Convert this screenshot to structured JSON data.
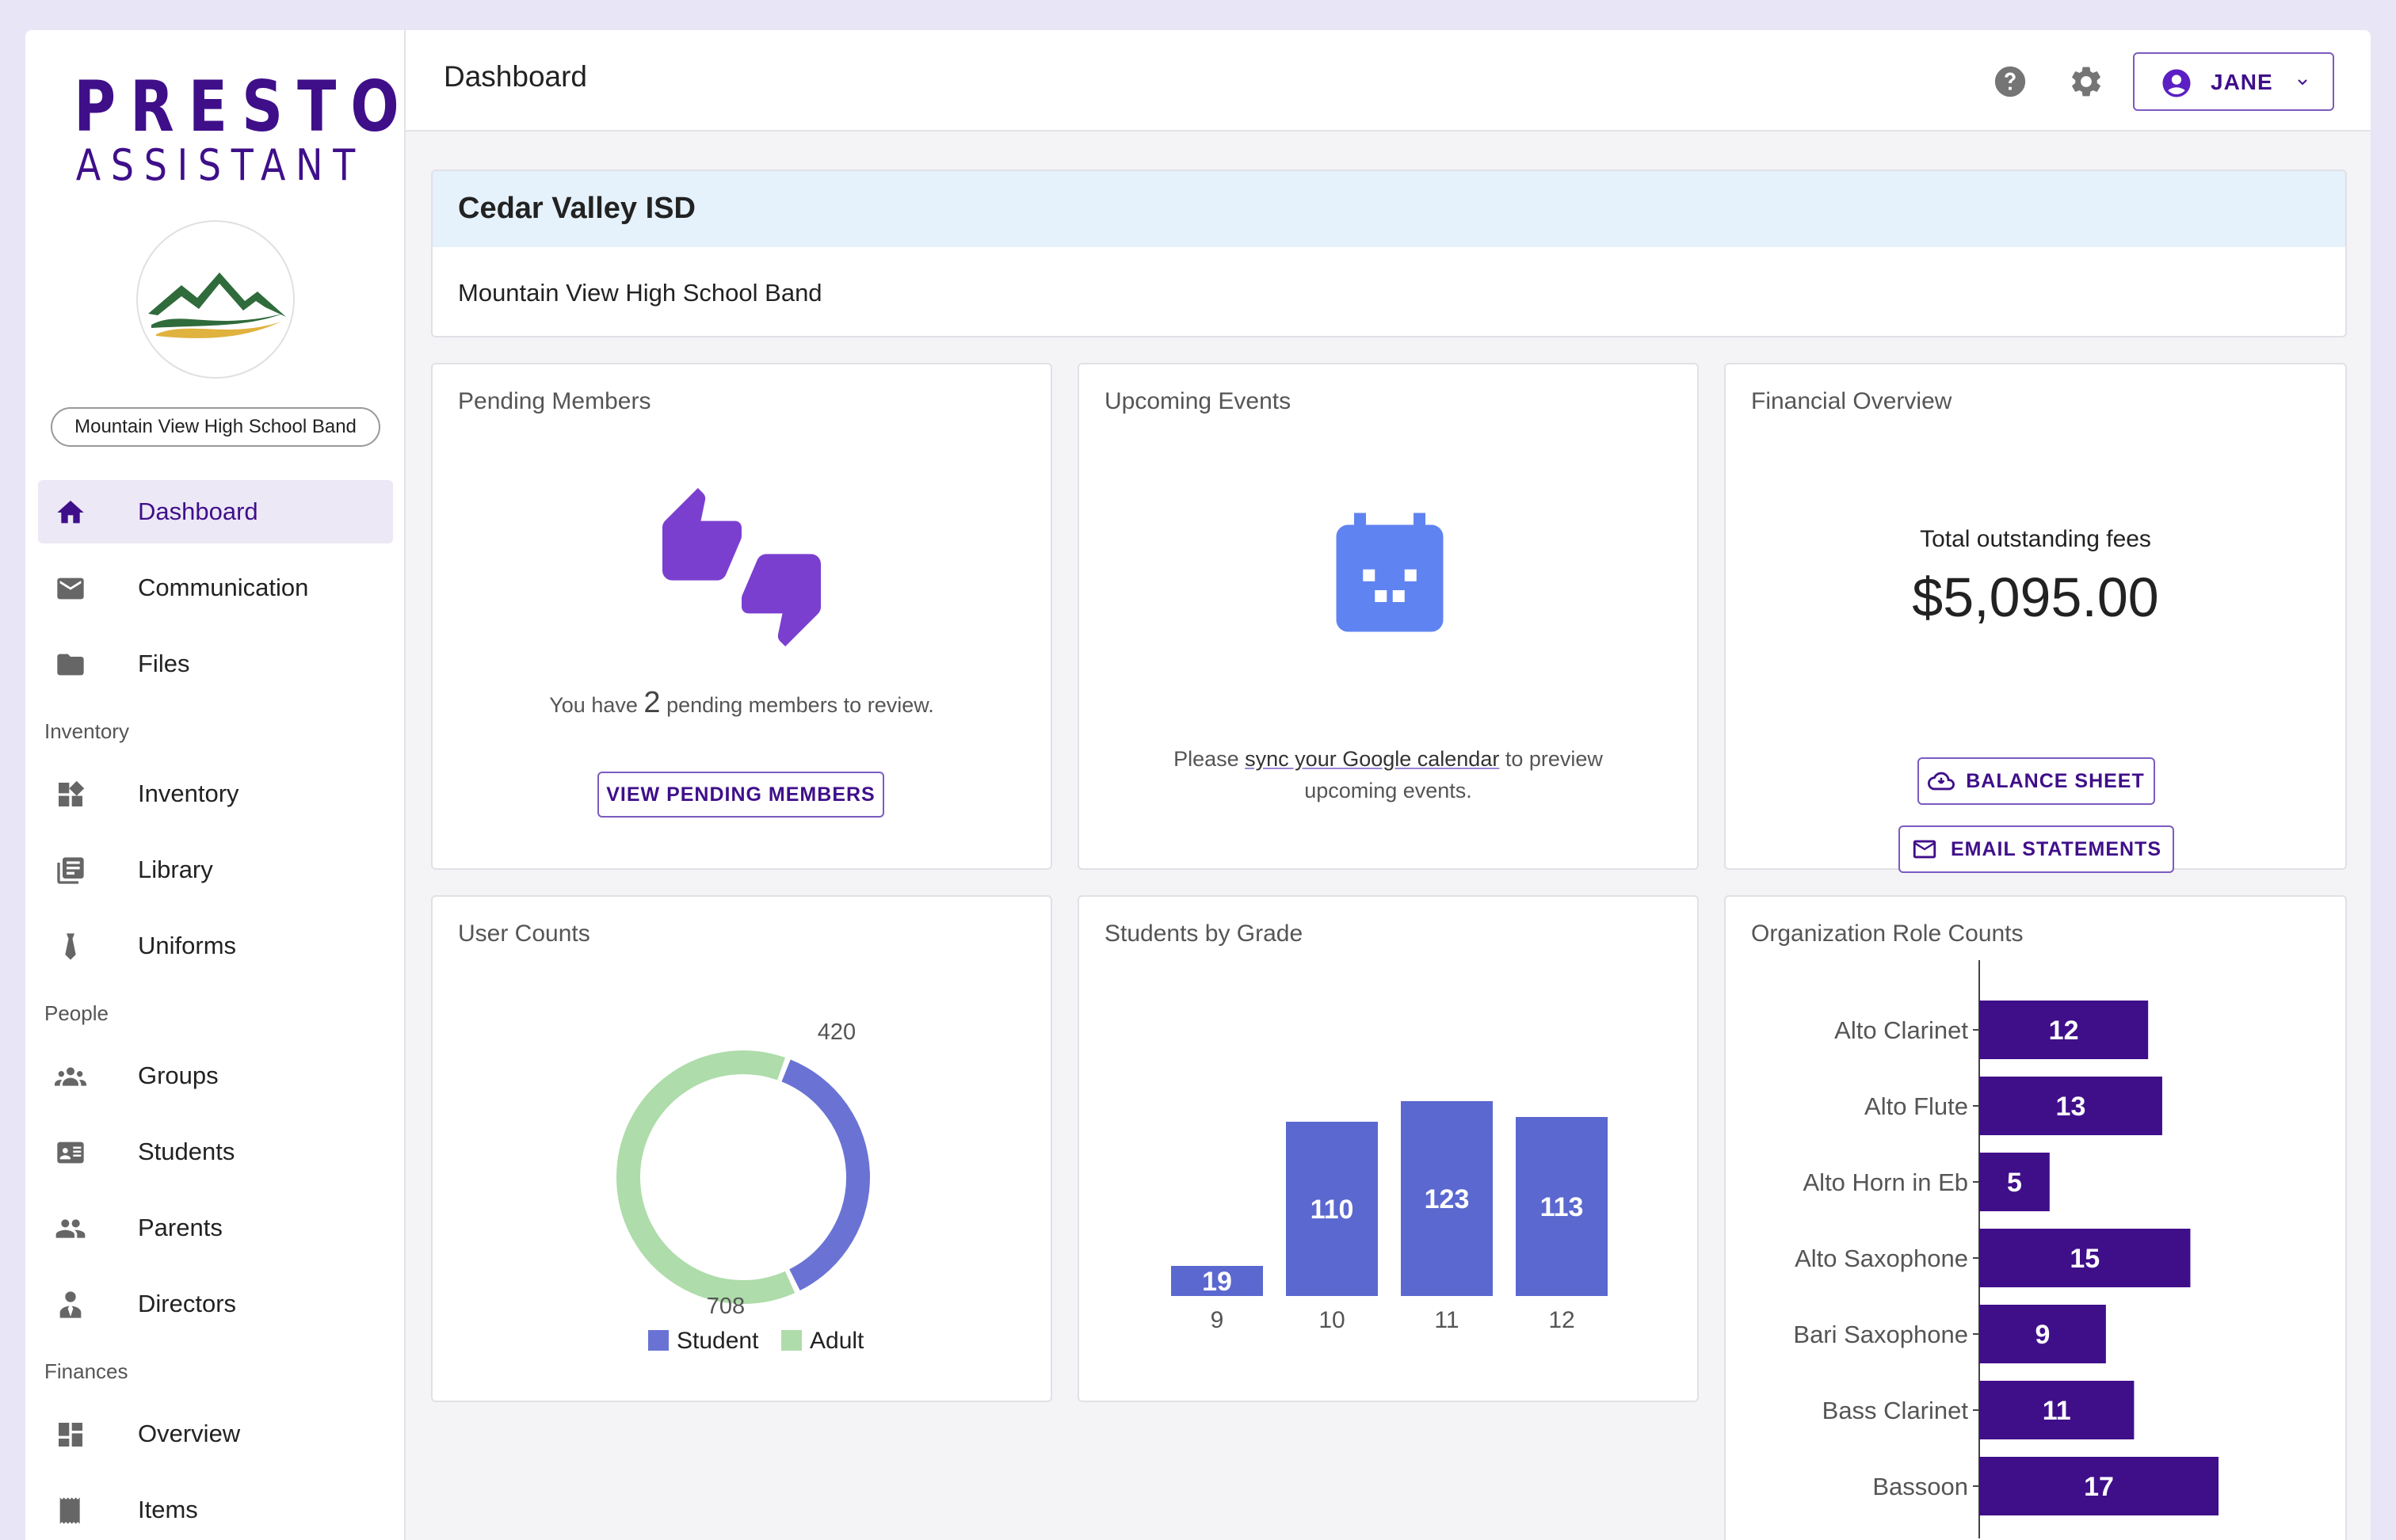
{
  "brand": {
    "line1": "PRESTO",
    "line2": "ASSISTANT"
  },
  "org_chip": "Mountain View High School Band",
  "nav": {
    "dashboard": "Dashboard",
    "communication": "Communication",
    "files": "Files",
    "inventory_section": "Inventory",
    "inventory": "Inventory",
    "library": "Library",
    "uniforms": "Uniforms",
    "people_section": "People",
    "groups": "Groups",
    "students": "Students",
    "parents": "Parents",
    "directors": "Directors",
    "finances_section": "Finances",
    "overview": "Overview",
    "items": "Items"
  },
  "header": {
    "title": "Dashboard",
    "user": "JANE"
  },
  "org_card": {
    "district": "Cedar Valley ISD",
    "organization": "Mountain View High School Band"
  },
  "pending": {
    "title": "Pending Members",
    "prefix": "You have",
    "count": "2",
    "suffix": "pending members to review.",
    "button": "VIEW PENDING MEMBERS"
  },
  "events": {
    "title": "Upcoming Events",
    "pre": "Please",
    "link": "sync your Google calendar",
    "post": "to preview",
    "line2": "upcoming events."
  },
  "financial": {
    "title": "Financial Overview",
    "label": "Total outstanding fees",
    "amount": "$5,095.00",
    "balance_button": "BALANCE SHEET",
    "email_button": "EMAIL STATEMENTS"
  },
  "colors": {
    "accent": "#3f0f8a",
    "student": "#6a73d4",
    "adult": "#aedcaa",
    "bar": "#5b68cf",
    "role_bar": "#3f0f8a",
    "pending_icon": "#7b3fd0",
    "calendar_icon": "#5f83f0"
  },
  "chart_data": [
    {
      "type": "pie",
      "title": "User Counts",
      "categories": [
        "Student",
        "Adult"
      ],
      "values": [
        420,
        708
      ],
      "legend": "bottom"
    },
    {
      "type": "bar",
      "title": "Students by Grade",
      "categories": [
        "9",
        "10",
        "11",
        "12"
      ],
      "values": [
        19,
        110,
        123,
        113
      ]
    },
    {
      "type": "bar",
      "orientation": "horizontal",
      "title": "Organization Role Counts",
      "categories": [
        "Alto Clarinet",
        "Alto Flute",
        "Alto Horn in Eb",
        "Alto Saxophone",
        "Bari Saxophone",
        "Bass Clarinet",
        "Bassoon"
      ],
      "values": [
        12,
        13,
        5,
        15,
        9,
        11,
        17
      ]
    }
  ]
}
